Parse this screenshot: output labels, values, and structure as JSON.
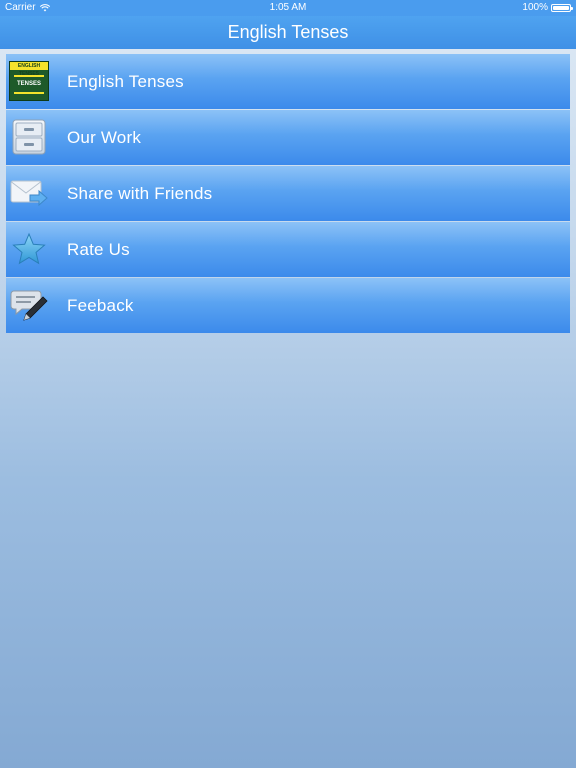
{
  "status_bar": {
    "carrier": "Carrier",
    "time": "1:05 AM",
    "battery": "100%",
    "battery_level": 1.0
  },
  "nav": {
    "title": "English Tenses"
  },
  "menu": {
    "items": [
      {
        "label": "English Tenses",
        "icon": "app-logo-icon"
      },
      {
        "label": "Our Work",
        "icon": "drawer-cabinet-icon"
      },
      {
        "label": "Share with Friends",
        "icon": "envelope-share-icon"
      },
      {
        "label": "Rate Us",
        "icon": "star-icon"
      },
      {
        "label": "Feeback",
        "icon": "comment-pencil-icon"
      }
    ]
  },
  "logo": {
    "top_text": "ENGLISH TENSES",
    "mid_text": "TENSES"
  },
  "colors": {
    "accent": "#4a9cee",
    "row_top": "#8cc2f7",
    "row_bottom": "#3c8aeb",
    "text": "#ffffff"
  }
}
